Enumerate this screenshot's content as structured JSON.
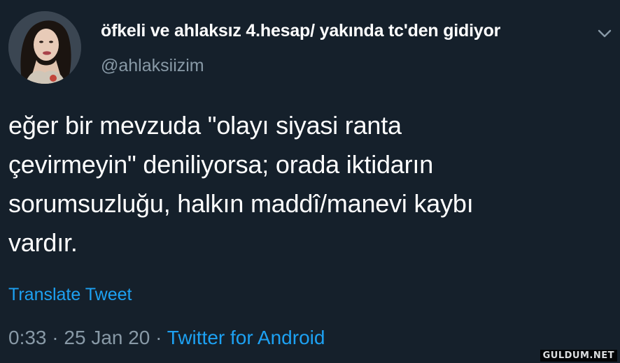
{
  "tweet": {
    "display_name": "öfkeli ve ahlaksız 4.hesap/ yakında tc'den gidiyor",
    "handle": "@ahlaksiizim",
    "text": "eğer bir mevzuda \"olayı siyasi ranta\nçevirmeyin\" deniliyorsa; orada iktidarın\nsorumsuzluğu, halkın maddî/manevi kaybı\nvardır.",
    "translate_label": "Translate Tweet",
    "time": "0:33",
    "separator": "·",
    "date": "25 Jan 20",
    "source": "Twitter for Android"
  },
  "icons": {
    "chevron": "chevron-down-icon",
    "avatar": "profile-photo"
  },
  "watermark": "GULDUM.NET",
  "colors": {
    "background": "#15202b",
    "primary_text": "#ffffff",
    "secondary_text": "#8899a6",
    "link": "#1da1f2"
  }
}
